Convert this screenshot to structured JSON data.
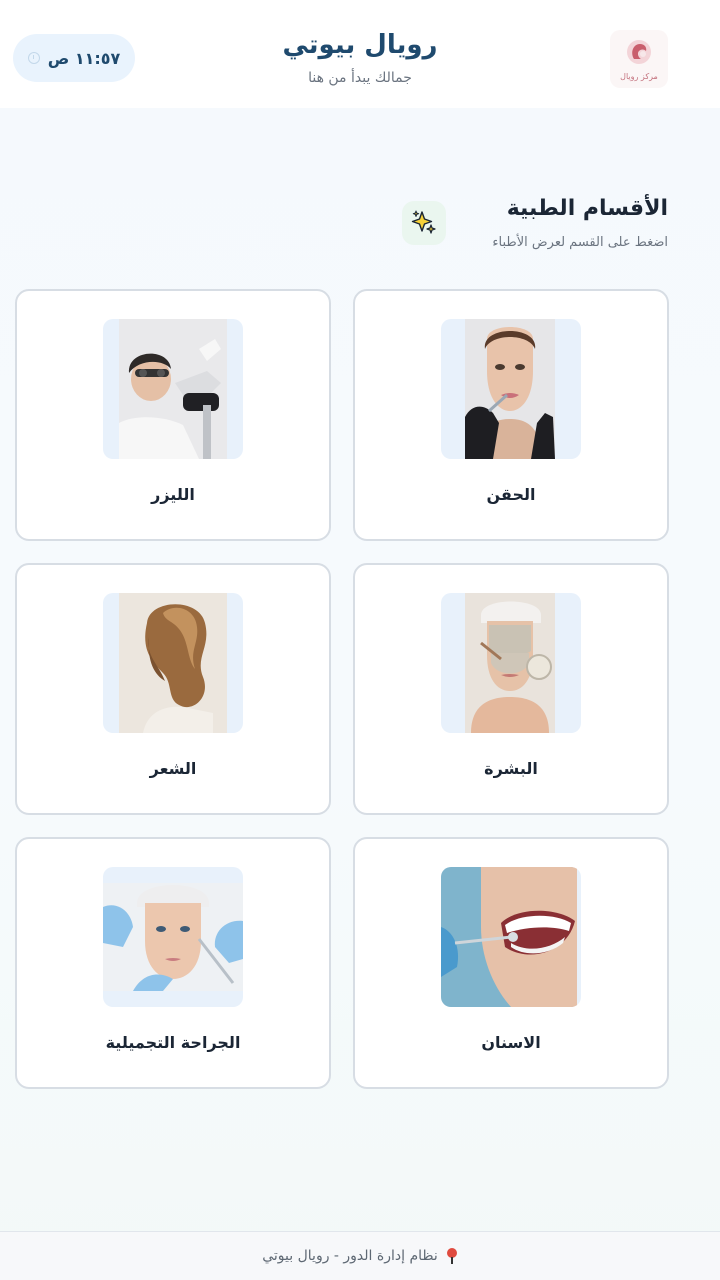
{
  "header": {
    "logo_text": "مركز رويال",
    "title": "رويال بيوتي",
    "subtitle": "جمالك يبدأ من هنا",
    "time": "١١:٥٧ ص"
  },
  "section": {
    "title": "الأقسام الطبية",
    "subtitle": "اضغط على القسم لعرض الأطباء",
    "icon": "sparkles-icon"
  },
  "departments": [
    {
      "label": "الحقن",
      "image": "injection-portrait"
    },
    {
      "label": "الليزر",
      "image": "laser-treatment"
    },
    {
      "label": "البشرة",
      "image": "facial-mask"
    },
    {
      "label": "الشعر",
      "image": "wavy-hair"
    },
    {
      "label": "الاسنان",
      "image": "dental-smile"
    },
    {
      "label": "الجراحة التجميلية",
      "image": "cosmetic-surgery"
    }
  ],
  "footer": {
    "text": "نظام إدارة الدور - رويال بيوتي"
  },
  "colors": {
    "brand": "#1f4a6e",
    "pill_bg": "#e9f3fd",
    "card_border": "#d7dde4"
  }
}
